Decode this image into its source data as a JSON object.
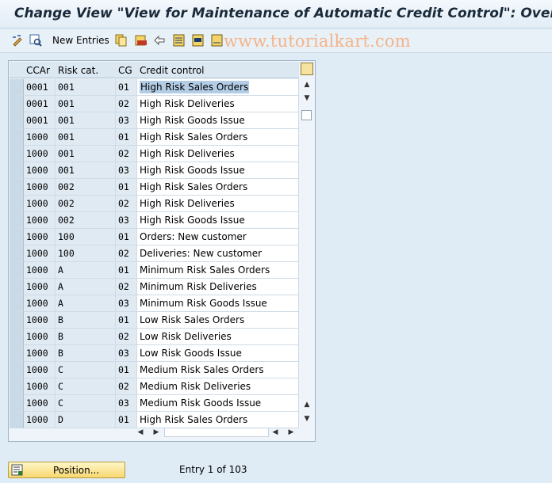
{
  "window": {
    "title": "Change View \"View for Maintenance of Automatic Credit Control\": Overvi"
  },
  "toolbar": {
    "new_entries_label": "New Entries",
    "icons": [
      "change-display-icon",
      "other-view-icon",
      "copy-icon",
      "delete-icon",
      "undo-icon",
      "select-all-icon",
      "select-block-icon",
      "deselect-all-icon"
    ]
  },
  "watermark": "www.tutorialkart.com",
  "table": {
    "columns": [
      "CCAr",
      "Risk cat.",
      "CG",
      "Credit control"
    ],
    "rows": [
      {
        "ccar": "0001",
        "risk": "001",
        "cg": "01",
        "cc": "High Risk Sales Orders",
        "selected": true
      },
      {
        "ccar": "0001",
        "risk": "001",
        "cg": "02",
        "cc": "High Risk Deliveries"
      },
      {
        "ccar": "0001",
        "risk": "001",
        "cg": "03",
        "cc": "High Risk Goods Issue"
      },
      {
        "ccar": "1000",
        "risk": "001",
        "cg": "01",
        "cc": "High Risk Sales Orders"
      },
      {
        "ccar": "1000",
        "risk": "001",
        "cg": "02",
        "cc": "High Risk Deliveries"
      },
      {
        "ccar": "1000",
        "risk": "001",
        "cg": "03",
        "cc": "High Risk Goods Issue"
      },
      {
        "ccar": "1000",
        "risk": "002",
        "cg": "01",
        "cc": "High Risk Sales Orders"
      },
      {
        "ccar": "1000",
        "risk": "002",
        "cg": "02",
        "cc": "High Risk Deliveries"
      },
      {
        "ccar": "1000",
        "risk": "002",
        "cg": "03",
        "cc": "High Risk Goods Issue"
      },
      {
        "ccar": "1000",
        "risk": "100",
        "cg": "01",
        "cc": "Orders: New customer"
      },
      {
        "ccar": "1000",
        "risk": "100",
        "cg": "02",
        "cc": "Deliveries: New customer"
      },
      {
        "ccar": "1000",
        "risk": "A",
        "cg": "01",
        "cc": "Minimum Risk Sales Orders"
      },
      {
        "ccar": "1000",
        "risk": "A",
        "cg": "02",
        "cc": "Minimum Risk Deliveries"
      },
      {
        "ccar": "1000",
        "risk": "A",
        "cg": "03",
        "cc": "Minimum Risk Goods Issue"
      },
      {
        "ccar": "1000",
        "risk": "B",
        "cg": "01",
        "cc": "Low Risk Sales Orders"
      },
      {
        "ccar": "1000",
        "risk": "B",
        "cg": "02",
        "cc": "Low Risk Deliveries"
      },
      {
        "ccar": "1000",
        "risk": "B",
        "cg": "03",
        "cc": "Low Risk Goods Issue"
      },
      {
        "ccar": "1000",
        "risk": "C",
        "cg": "01",
        "cc": "Medium Risk Sales Orders"
      },
      {
        "ccar": "1000",
        "risk": "C",
        "cg": "02",
        "cc": "Medium Risk Deliveries"
      },
      {
        "ccar": "1000",
        "risk": "C",
        "cg": "03",
        "cc": "Medium Risk Goods Issue"
      },
      {
        "ccar": "1000",
        "risk": "D",
        "cg": "01",
        "cc": "High Risk Sales Orders"
      }
    ]
  },
  "footer": {
    "position_label": "Position...",
    "entry_text": "Entry 1 of 103"
  }
}
